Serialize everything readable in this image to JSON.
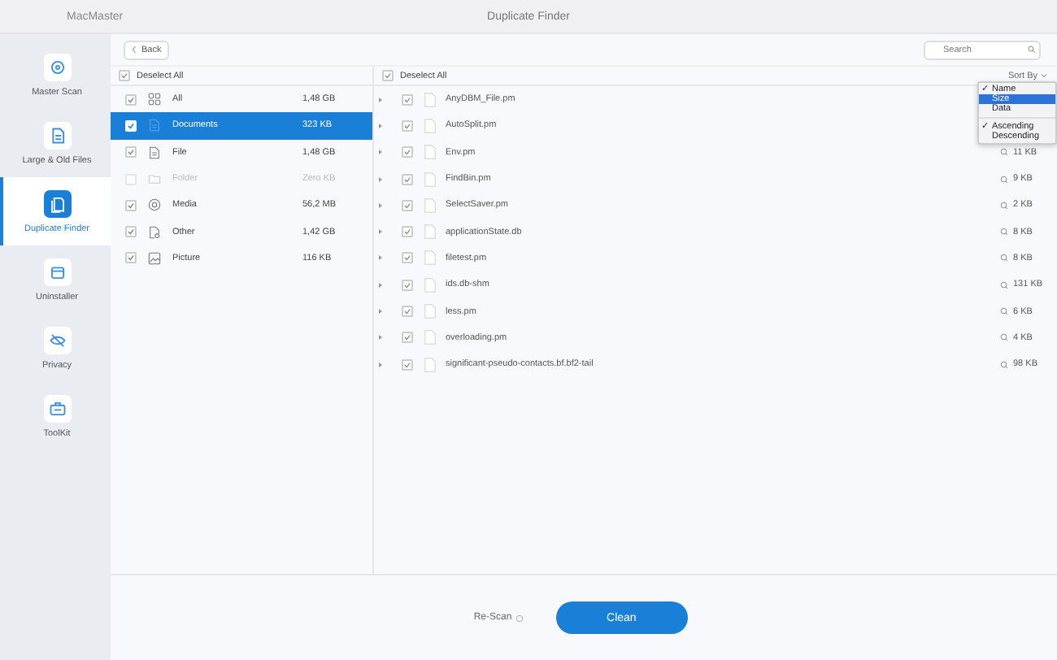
{
  "window": {
    "title": "MacMaster",
    "page_title": "Duplicate Finder"
  },
  "sidebar": {
    "items": [
      {
        "label": "Master Scan",
        "selected": false
      },
      {
        "label": "Large & Old Files",
        "selected": false
      },
      {
        "label": "Duplicate Finder",
        "selected": true
      },
      {
        "label": "Uninstaller",
        "selected": false
      },
      {
        "label": "Privacy",
        "selected": false
      },
      {
        "label": "ToolKit",
        "selected": false
      }
    ]
  },
  "back_button": "Back",
  "search": {
    "placeholder": "Search"
  },
  "categories": {
    "deselect_all": "Deselect All",
    "all_checked": true,
    "items": [
      {
        "name": "All",
        "size": "1,48 GB",
        "checked": true,
        "disabled": false,
        "selected": false
      },
      {
        "name": "Documents",
        "size": "323 KB",
        "checked": true,
        "disabled": false,
        "selected": true
      },
      {
        "name": "File",
        "size": "1,48 GB",
        "checked": true,
        "disabled": false,
        "selected": false
      },
      {
        "name": "Folder",
        "size": "Zero KB",
        "checked": false,
        "disabled": true,
        "selected": false
      },
      {
        "name": "Media",
        "size": "56,2 MB",
        "checked": true,
        "disabled": false,
        "selected": false
      },
      {
        "name": "Other",
        "size": "1,42 GB",
        "checked": true,
        "disabled": false,
        "selected": false
      },
      {
        "name": "Picture",
        "size": "116 KB",
        "checked": true,
        "disabled": false,
        "selected": false
      }
    ]
  },
  "files": {
    "deselect_all": "Deselect All",
    "all_checked": true,
    "sort_label": "Sort By",
    "items": [
      {
        "name": "AnyDBM_File.pm",
        "checked": true
      },
      {
        "name": "AutoSplit.pm",
        "checked": true
      },
      {
        "name": "Env.pm",
        "size": "11 KB",
        "checked": true
      },
      {
        "name": "FindBin.pm",
        "size": "9 KB",
        "checked": true
      },
      {
        "name": "SelectSaver.pm",
        "size": "2 KB",
        "checked": true
      },
      {
        "name": "applicationState.db",
        "size": "8 KB",
        "checked": true
      },
      {
        "name": "filetest.pm",
        "size": "8 KB",
        "checked": true
      },
      {
        "name": "ids.db-shm",
        "size": "131 KB",
        "checked": true
      },
      {
        "name": "less.pm",
        "size": "6 KB",
        "checked": true
      },
      {
        "name": "overloading.pm",
        "size": "4 KB",
        "checked": true
      },
      {
        "name": "significant-pseudo-contacts.bf.bf2-tail",
        "size": "98 KB",
        "checked": true
      }
    ]
  },
  "sort_menu": {
    "groups": [
      [
        {
          "label": "Name",
          "checked": true,
          "selected": false
        },
        {
          "label": "Size",
          "checked": false,
          "selected": true
        },
        {
          "label": "Data",
          "checked": false,
          "selected": false
        }
      ],
      [
        {
          "label": "Ascending",
          "checked": true,
          "selected": false
        },
        {
          "label": "Descending",
          "checked": false,
          "selected": false
        }
      ]
    ],
    "check_mark": "✓"
  },
  "rescan_button": "Re-Scan",
  "clean_button": "Clean"
}
